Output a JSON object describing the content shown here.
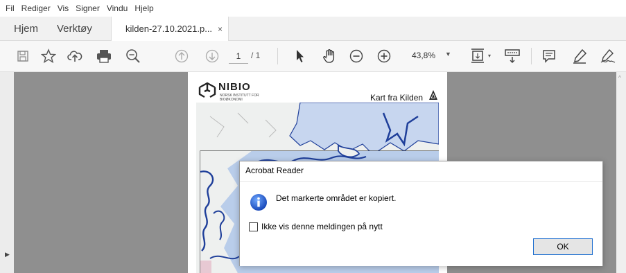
{
  "menu": [
    "Fil",
    "Rediger",
    "Vis",
    "Signer",
    "Vindu",
    "Hjelp"
  ],
  "tabs": {
    "home": "Hjem",
    "tools": "Verktøy",
    "document": "kilden-27.10.2021.p...",
    "close_glyph": "×"
  },
  "toolbar": {
    "page_current": "1",
    "page_total": "/ 1",
    "zoom": "43,8%",
    "icons": [
      "save-icon",
      "star-icon",
      "upload-cloud-icon",
      "print-icon",
      "search-zoom-icon",
      "page-up-icon",
      "page-down-icon",
      "select-arrow-icon",
      "hand-icon",
      "zoom-out-icon",
      "zoom-in-icon",
      "fit-page-icon",
      "scroll-mode-icon",
      "comment-icon",
      "highlight-pen-icon",
      "sign-icon"
    ]
  },
  "document": {
    "org_name": "NIBIO",
    "org_subtitle_1": "NORSK INSTITUTT FOR",
    "org_subtitle_2": "BIOØKONOMI",
    "map_title": "Kart fra Kilden"
  },
  "dialog": {
    "title": "Acrobat Reader",
    "message": "Det markerte området er kopiert.",
    "checkbox_label": "Ikke vis denne meldingen på nytt",
    "checkbox_checked": false,
    "ok_label": "OK"
  },
  "colors": {
    "map_water": "#c7d6ef",
    "map_land": "#eef0ef",
    "map_coast": "#1f3f9a",
    "dialog_button_border": "#1e6fd0",
    "doc_background": "#8f8f8f"
  }
}
